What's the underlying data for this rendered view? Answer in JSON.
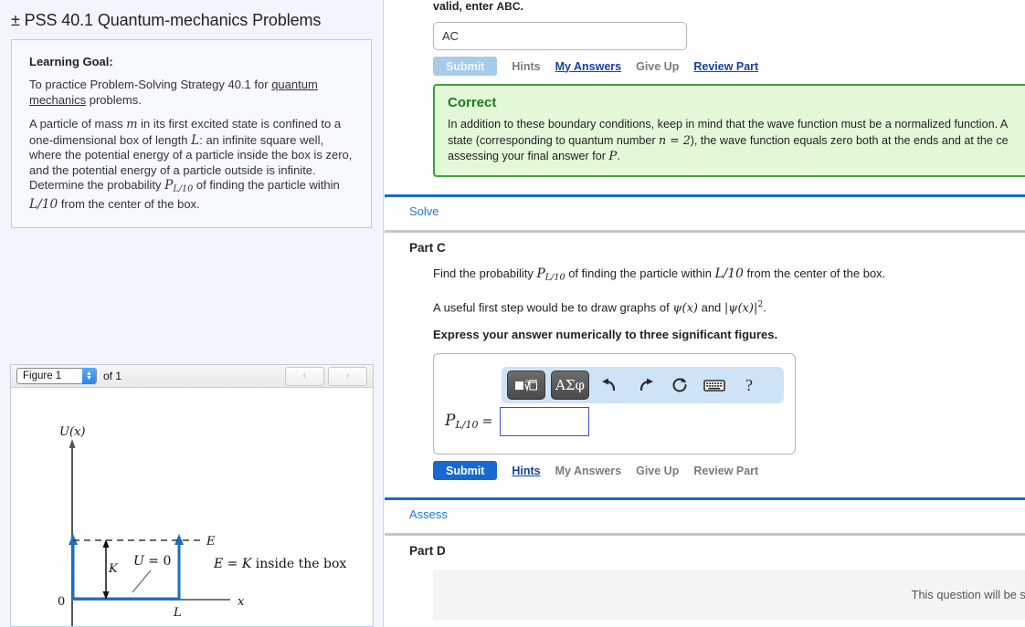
{
  "problem": {
    "title": "± PSS 40.1 Quantum-mechanics Problems",
    "learning_goal_label": "Learning Goal:",
    "learning_goal_pre": "To practice Problem-Solving Strategy 40.1 for ",
    "learning_goal_link": "quantum mechanics",
    "learning_goal_post": " problems.",
    "statement_1": "A particle of mass ",
    "statement_m": "m",
    "statement_2": " in its first excited state is confined to a one-dimensional box of length ",
    "statement_L": "L",
    "statement_3": ": an infinite square well, where the potential energy of a particle inside the box is zero, and the potential energy of a particle outside is infinite. Determine the probability ",
    "statement_P": "P",
    "statement_P_sub": "L/10",
    "statement_4": " of finding the particle within ",
    "statement_L10": "L/10",
    "statement_5": " from the center of the box."
  },
  "figure": {
    "select_value": "Figure 1",
    "of_label": "of 1",
    "prev_icon": "‹",
    "next_icon": "›",
    "spinner_up": "▲",
    "spinner_down": "▼",
    "axis_y_label": "U(x)",
    "axis_x_label": "x",
    "origin_label": "0",
    "length_label": "L",
    "energy_label": "E",
    "kinetic_label": "K",
    "potential_label": "U = 0",
    "note": "E = K inside the box",
    "line_color": "#1a6fc4",
    "axis_color": "#5a5a5a"
  },
  "part_b": {
    "tail_text_pre": "valid, enter ",
    "tail_text_sc": "ABC",
    "tail_text_post": ".",
    "answer_value": "AC",
    "submit_label": "Submit",
    "submit_state": "disabled",
    "links": [
      {
        "label": "Hints",
        "active": false
      },
      {
        "label": "My Answers",
        "active": true
      },
      {
        "label": "Give Up",
        "active": false
      },
      {
        "label": "Review Part",
        "active": true
      }
    ],
    "feedback": {
      "title": "Correct",
      "line_1_a": "In addition to these boundary conditions, keep in mind that the wave function must be a normalized function. A",
      "line_2_a": "state (corresponding to quantum number ",
      "line_2_n": "n = 2",
      "line_2_b": "), the wave function equals zero both at the ends and at the ce",
      "line_3_a": "assessing your final answer for ",
      "line_3_P": "P",
      "line_3_b": "."
    }
  },
  "solve_stage": {
    "label": "Solve"
  },
  "part_c": {
    "heading": "Part C",
    "question_a": "Find the probability ",
    "question_P": "P",
    "question_P_sub": "L/10",
    "question_b": " of finding the particle within ",
    "question_L10": "L/10",
    "question_c": " from the center of the box.",
    "hint_a": "A useful first step would be to draw graphs of ",
    "hint_psi": "ψ(x)",
    "hint_b": " and ",
    "hint_psi2": "|ψ(x)|",
    "hint_sup": "2",
    "hint_c": ".",
    "instruction": "Express your answer numerically to three significant figures.",
    "answer_label_P": "P",
    "answer_label_sub": "L/10",
    "answer_label_eq": "=",
    "answer_value": "",
    "toolbar": [
      {
        "name": "math-template-button",
        "glyph": "template"
      },
      {
        "name": "greek-letters-button",
        "glyph": "ΑΣφ"
      },
      {
        "name": "undo-icon",
        "glyph": "undo"
      },
      {
        "name": "redo-icon",
        "glyph": "redo"
      },
      {
        "name": "reset-icon",
        "glyph": "reset"
      },
      {
        "name": "keyboard-icon",
        "glyph": "keyboard"
      },
      {
        "name": "help-icon",
        "glyph": "?"
      }
    ],
    "submit_label": "Submit",
    "submit_state": "active",
    "links": [
      {
        "label": "Hints",
        "active": true
      },
      {
        "label": "My Answers",
        "active": false
      },
      {
        "label": "Give Up",
        "active": false
      },
      {
        "label": "Review Part",
        "active": false
      }
    ]
  },
  "assess_stage": {
    "label": "Assess"
  },
  "part_d": {
    "heading": "Part D",
    "locked_message": "This question will be shown after you complete previous question("
  },
  "colors": {
    "accent_blue": "#1769d2",
    "link_blue": "#1240ab",
    "stage_blue": "#2277dd",
    "correct_green": "#1d7a1d",
    "correct_bg": "#e3f8d8",
    "panel_bg": "#f2f6fc"
  }
}
